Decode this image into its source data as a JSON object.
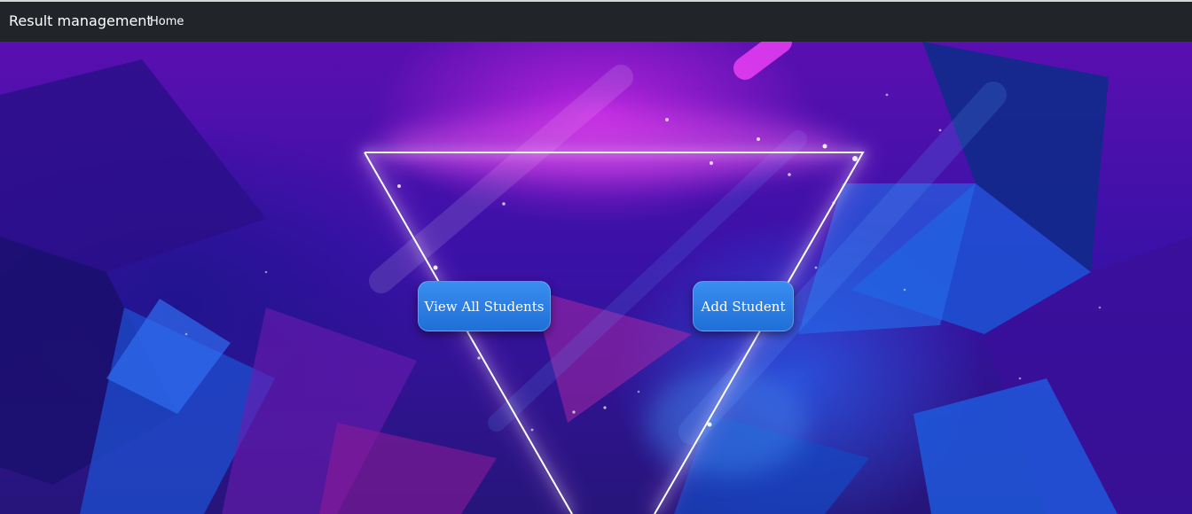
{
  "navbar": {
    "brand": "Result management",
    "links": [
      {
        "label": "Home"
      }
    ]
  },
  "hero": {
    "buttons": {
      "view_all": "View All Students",
      "add_student": "Add Student"
    }
  },
  "colors": {
    "navbar_bg": "#212529",
    "button_bg": "#2a7fe8",
    "neon_line": "#ffffff"
  }
}
